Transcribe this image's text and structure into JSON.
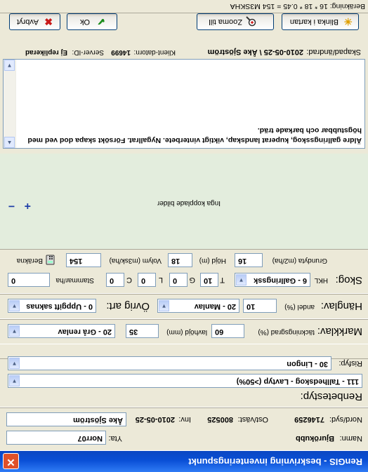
{
  "window": {
    "title": "RenGIS - beskrivning inventeringspunkt",
    "close_glyph": "✕"
  },
  "info": {
    "yta_label": "Yta:",
    "yta_value": "Norr07",
    "namn_label": "Namn:",
    "namn_value": "Bjurökubb",
    "nordsyd_label": "Nord/syd:",
    "nordsyd_value": "7146259",
    "ostvast_label": "Ost/väst:",
    "ostvast_value": "800525",
    "inv_label": "Inv:",
    "inv_value": "2010-05-25",
    "inv_person": "Åke Sjöström"
  },
  "renhet": {
    "label": "Renbetestyp:",
    "value": "111 - Tallhedskog - Lavtyp (>50%)",
    "risfyp_label": "Risfyp:",
    "risfyp_value": "30 - Lingon"
  },
  "markklav": {
    "label": "Markklav:",
    "tackning_label": "täckningsgrad (%)",
    "tackning_value": "60",
    "hojd_label": "lavhöjd (mm)",
    "hojd_value": "35",
    "combo_value": "20 - Grå renlav"
  },
  "hanglav": {
    "label": "Hänglav:",
    "andel_label": "andel (%)",
    "andel_value": "10",
    "combo_value": "20 - Manlav",
    "ovrig_label": "Övrig art:",
    "ovrig_value": "0 - Uppgift saknas"
  },
  "skog": {
    "label": "Skog:",
    "hkl_label": "HKL",
    "hkl_value": "6 - Gallringssk",
    "t_label": "T",
    "t_value": "10",
    "g_label": "G",
    "g_value": "0",
    "l_label": "L",
    "l_value": "0",
    "c_label": "C",
    "c_value": "0",
    "stammar_label": "Stammar/ha",
    "stammar_value": "0",
    "grundyta_label": "Grundyta (m2/ha)",
    "grundyta_value": "16",
    "hojd_label": "Höjd (m)",
    "hojd_value": "18",
    "volym_label": "Volym (m3sk/ha)",
    "volym_value": "154",
    "berakna_label": "Beräkna"
  },
  "photos": {
    "empty_text": "Inga kopplade bilder",
    "add": "+",
    "remove": "−"
  },
  "notes": {
    "text": "Äldre gallringsskog, kuperat landskap, viktigt vinterbete. Nygallrat. Försökt skapa dod ved med högstubbar och barkade träd."
  },
  "meta": {
    "skapad_label": "Skapad/ändrad:",
    "skapad_value": "2010-05-25 \\ Åke Sjöström",
    "klient_label": "Klient-datorn:",
    "klient_value": "14699",
    "server_label": "Server-ID:",
    "server_value": "Ej replikerad"
  },
  "buttons": {
    "blinka": "Blinka i kartan",
    "zooma": "Zooma till",
    "ok": "Ok",
    "avbryt": "Avbryt"
  },
  "status": {
    "text": "Beräkning: 16 * 18 * 0.45 = 154 M3SKHA"
  }
}
